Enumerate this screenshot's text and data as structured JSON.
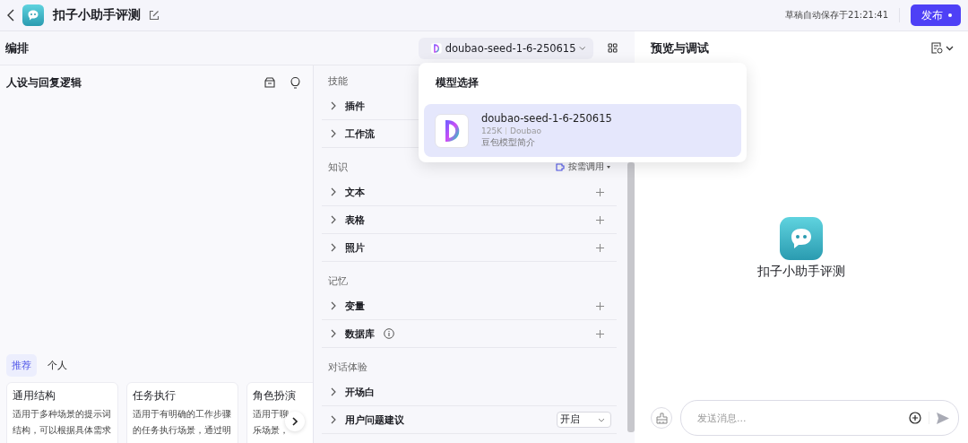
{
  "header": {
    "title": "扣子小助手评测",
    "save_status": "草稿自动保存于21:21:41",
    "publish_label": "发布"
  },
  "toolbar": {
    "section_title": "编排",
    "model_name": "doubao-seed-1-6-250615",
    "preview_title": "预览与调试"
  },
  "model_menu": {
    "title": "模型选择",
    "models": [
      {
        "name": "doubao-seed-1-6-250615",
        "context": "125K",
        "provider": "Doubao",
        "description": "豆包模型简介",
        "selected": true
      }
    ]
  },
  "persona": {
    "title": "人设与回复逻辑",
    "template_tabs": [
      {
        "label": "推荐",
        "selected": true
      },
      {
        "label": "个人",
        "selected": false
      }
    ],
    "templates": [
      {
        "title": "通用结构",
        "lines": [
          "适用于多种场景的提示词",
          "结构，可以根据具体需求"
        ]
      },
      {
        "title": "任务执行",
        "lines": [
          "适用于有明确的工作步骤",
          "的任务执行场景，通过明"
        ]
      },
      {
        "title": "角色扮演",
        "lines": [
          "适用于聊",
          "乐场景，"
        ]
      }
    ]
  },
  "skills": {
    "sections": [
      {
        "title": "技能",
        "items": [
          {
            "label": "插件",
            "kind": "plain"
          },
          {
            "label": "工作流",
            "kind": "plain"
          }
        ]
      },
      {
        "title": "知识",
        "action": "按需调用",
        "items": [
          {
            "label": "文本",
            "kind": "add"
          },
          {
            "label": "表格",
            "kind": "add"
          },
          {
            "label": "照片",
            "kind": "add"
          }
        ]
      },
      {
        "title": "记忆",
        "items": [
          {
            "label": "变量",
            "kind": "add"
          },
          {
            "label": "数据库",
            "kind": "info"
          }
        ]
      },
      {
        "title": "对话体验",
        "items": [
          {
            "label": "开场白",
            "kind": "plain"
          },
          {
            "label": "用户问题建议",
            "kind": "select",
            "value": "开启"
          }
        ]
      }
    ]
  },
  "preview": {
    "bot_name": "扣子小助手评测",
    "input_placeholder": "发送消息..."
  }
}
